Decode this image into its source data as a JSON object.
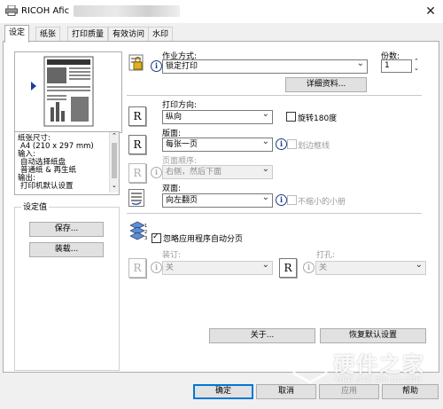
{
  "window": {
    "title": "RICOH Afic",
    "close_glyph": "✕"
  },
  "tabs": [
    "设定",
    "纸张",
    "打印质量",
    "有效访问",
    "水印"
  ],
  "left": {
    "info_lines": [
      "纸张尺寸:",
      "A4 (210 x 297 mm)",
      "输入:",
      "自动选择纸盘",
      "普通纸 & 再生纸",
      "输出:",
      "打印机默认设置"
    ],
    "settings_group_label": "设定值",
    "save_label": "保存...",
    "load_label": "装载..."
  },
  "job": {
    "label": "作业方式:",
    "value": "锁定打印",
    "details_label": "详细资料..."
  },
  "copies": {
    "label": "份数:",
    "value": "1"
  },
  "orientation": {
    "label": "打印方向:",
    "value": "纵向",
    "rotate_label": "旋转180度"
  },
  "layout": {
    "label": "版面:",
    "value": "每张一页",
    "border_label": "划边框线"
  },
  "page_order": {
    "label": "页面顺序:",
    "value": "右侧，然后下面"
  },
  "duplex": {
    "label": "双面:",
    "value": "向左翻页",
    "booklet_label": "不缩小的小册"
  },
  "collate": {
    "ignore_label": "忽略应用程序自动分页",
    "staple_label": "装订:",
    "staple_value": "关",
    "punch_label": "打孔:",
    "punch_value": "关"
  },
  "bottom": {
    "about_label": "关于...",
    "restore_label": "恢复默认设置",
    "ok_label": "确定",
    "cancel_label": "取消",
    "apply_label": "应用",
    "help_label": "帮助"
  },
  "watermark": {
    "text": "硬件之家",
    "subtext": "YING JIAN ZHI JIA.COM"
  },
  "colors": {
    "accent": "#0078d7",
    "arrow": "#1a3fa0"
  }
}
